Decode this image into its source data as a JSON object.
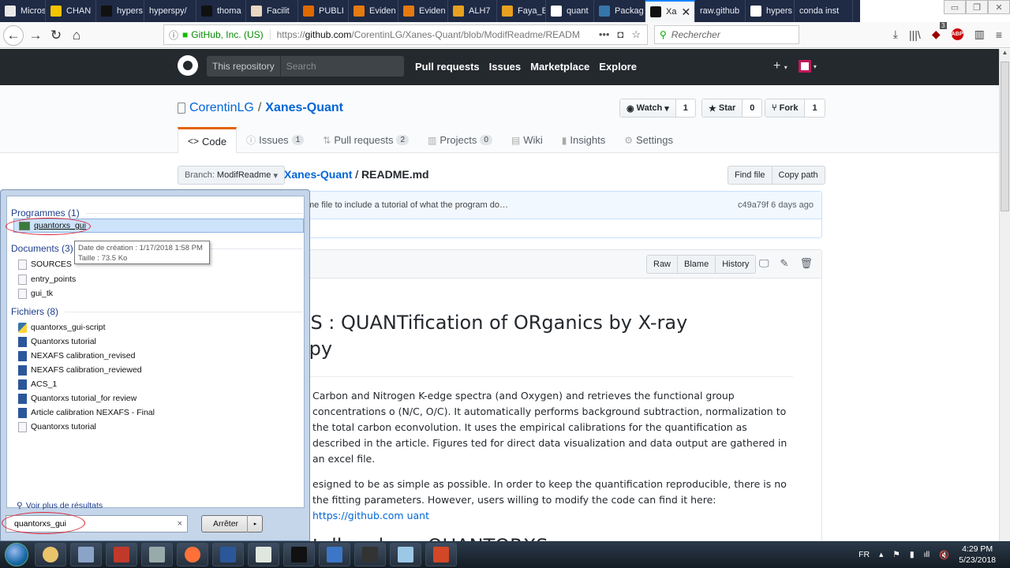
{
  "browser": {
    "tabs": [
      {
        "label": "Microsoft",
        "icon": "edge-icon",
        "color": "#e8e8e8"
      },
      {
        "label": "CHAN",
        "icon": "shield-icon",
        "color": "#f5c400"
      },
      {
        "label": "hypers",
        "icon": "github-icon",
        "color": "#111111"
      },
      {
        "label": "hyperspy/",
        "icon": "",
        "color": ""
      },
      {
        "label": "thoma",
        "icon": "github-icon",
        "color": "#111111"
      },
      {
        "label": "Facilit",
        "icon": "crest-icon",
        "color": "#e9d7c3"
      },
      {
        "label": "PUBLI",
        "icon": "jsg-icon",
        "color": "#e06a00"
      },
      {
        "label": "Eviden",
        "icon": "e-logo-icon",
        "color": "#e57a10"
      },
      {
        "label": "Eviden",
        "icon": "e-logo-icon",
        "color": "#e57a10"
      },
      {
        "label": "ALH7",
        "icon": "book-icon",
        "color": "#e8a020"
      },
      {
        "label": "Faya_E",
        "icon": "book-icon",
        "color": "#e8a020"
      },
      {
        "label": "quant",
        "icon": "package-icon",
        "color": "#ffffff"
      },
      {
        "label": "Packag",
        "icon": "python-icon",
        "color": "#3776ab"
      },
      {
        "label": "Xa",
        "icon": "github-icon",
        "color": "#111111",
        "active": true,
        "close": "✕"
      },
      {
        "label": "raw.github",
        "icon": "",
        "color": ""
      },
      {
        "label": "hypers",
        "icon": "package-icon",
        "color": "#ffffff"
      },
      {
        "label": "conda inst",
        "icon": "",
        "color": ""
      }
    ],
    "window_controls": {
      "minimize": "▭",
      "restore": "❐",
      "close": "✕"
    },
    "nav": {
      "back": "←",
      "forward": "→",
      "reload": "↻",
      "home": "⌂"
    },
    "urlbar": {
      "info": "ⓘ",
      "lock": "🔒",
      "org": "GitHub, Inc. (US)",
      "url_prefix": "https://",
      "url_domain": "github.com",
      "url_path": "/CorentinLG/Xanes-Quant/blob/ModifReadme/READM",
      "more": "•••",
      "pocket": "◘",
      "bookmark": "☆"
    },
    "search": {
      "placeholder": "Rechercher",
      "icon": "⚲"
    },
    "toolbar": {
      "download": "⤓",
      "library": "|||\\",
      "ublock_count": "3",
      "ublock": "◆",
      "abp": "ABP",
      "sidebar": "▥",
      "menu": "≡"
    }
  },
  "github": {
    "header": {
      "scope": "This repository",
      "search_placeholder": "Search",
      "nav": [
        "Pull requests",
        "Issues",
        "Marketplace",
        "Explore"
      ],
      "plus": "+",
      "caret": "▾"
    },
    "repo": {
      "owner": "CorentinLG",
      "sep": "/",
      "name": "Xanes-Quant",
      "watch": {
        "label": "Watch",
        "icon": "◉",
        "count": "1",
        "caret": "▾"
      },
      "star": {
        "label": "Star",
        "icon": "★",
        "count": "0"
      },
      "fork": {
        "label": "Fork",
        "icon": "⑂",
        "count": "1"
      },
      "tabs": [
        {
          "label": "Code",
          "icon": "<>",
          "count": null,
          "selected": true
        },
        {
          "label": "Issues",
          "icon": "ⓘ",
          "count": "1"
        },
        {
          "label": "Pull requests",
          "icon": "⇅",
          "count": "2"
        },
        {
          "label": "Projects",
          "icon": "▥",
          "count": "0"
        },
        {
          "label": "Wiki",
          "icon": "▤",
          "count": null
        },
        {
          "label": "Insights",
          "icon": "▮",
          "count": null
        },
        {
          "label": "Settings",
          "icon": "⚙",
          "count": null
        }
      ]
    },
    "file": {
      "branch_label": "Branch:",
      "branch": "ModifReadme",
      "branch_caret": "▾",
      "crumb_repo": "Xanes-Quant",
      "crumb_sep": " / ",
      "crumb_file": "README.md",
      "find_file": "Find file",
      "copy_path": "Copy path",
      "commit_message": "me file to include a tutorial of what the program do…",
      "commit_sha": "c49a79f",
      "commit_time": "6 days ago",
      "raw": "Raw",
      "blame": "Blame",
      "history": "History",
      "desktop_icon": "🖵",
      "edit_icon": "✎",
      "delete_icon": "🗑"
    },
    "readme": {
      "title_line1": "XS : QUANTification of ORganics by X-ray",
      "title_line2": "opy",
      "p1": "Carbon and Nitrogen K-edge spectra (and Oxygen) and retrieves the functional group concentrations o (N/C, O/C). It automatically performs background subtraction, normalization to the total carbon econvolution. It uses the empirical calibrations for the quantification as described in the article. Figures ted for direct data visualization and data output are gathered in an excel file.",
      "p2": "esigned to be as simple as possible. In order to keep the quantification reproducible, there is no  the fitting parameters. However, users willing to modify the code can find it here: ",
      "p2_link": "https://github.com",
      "p2_link2": "uant",
      "h2": "tall and run QUANTORXS."
    }
  },
  "start_menu": {
    "groups": [
      {
        "label": "Programmes (1)",
        "items": [
          {
            "name": "quantorxs_gui",
            "type": "app",
            "highlighted": true
          }
        ]
      },
      {
        "label": "Documents (3)",
        "items": [
          {
            "name": "SOURCES",
            "type": "doc"
          },
          {
            "name": "entry_points",
            "type": "doc"
          },
          {
            "name": "gui_tk",
            "type": "doc"
          }
        ]
      },
      {
        "label": "Fichiers (8)",
        "items": [
          {
            "name": "quantorxs_gui-script",
            "type": "py"
          },
          {
            "name": "Quantorxs tutorial",
            "type": "word"
          },
          {
            "name": "NEXAFS calibration_revised",
            "type": "word"
          },
          {
            "name": "NEXAFS calibration_reviewed",
            "type": "word"
          },
          {
            "name": "ACS_1",
            "type": "word"
          },
          {
            "name": "Quantorxs tutorial_for review",
            "type": "word"
          },
          {
            "name": "Article calibration NEXAFS - Final",
            "type": "word"
          },
          {
            "name": "Quantorxs tutorial",
            "type": "doc"
          }
        ]
      }
    ],
    "tooltip": {
      "line1": "Date de création : 1/17/2018 1:58 PM",
      "line2": "Taille : 73.5 Ko"
    },
    "more_results": "Voir plus de résultats",
    "search_value": "quantorxs_gui",
    "clear": "×",
    "shutdown": "Arrêter",
    "shutdown_arrow": "▸"
  },
  "taskbar": {
    "apps": [
      {
        "name": "explorer",
        "color": "#e9c46a"
      },
      {
        "name": "app-window",
        "color": "#8aa4c8"
      },
      {
        "name": "paint-tools",
        "color": "#c0392b"
      },
      {
        "name": "binoculars",
        "color": "#9aa"
      },
      {
        "name": "firefox",
        "color": "#ff7139"
      },
      {
        "name": "word",
        "color": "#2b579a"
      },
      {
        "name": "viewer",
        "color": "#dfe8e0"
      },
      {
        "name": "terminal",
        "color": "#111111"
      },
      {
        "name": "writer",
        "color": "#3c76c6"
      },
      {
        "name": "cmd",
        "color": "#333333"
      },
      {
        "name": "notepad",
        "color": "#9cc8e8"
      },
      {
        "name": "powerpoint",
        "color": "#d24726"
      }
    ],
    "lang": "FR",
    "tray_icons": [
      "▴",
      "⚑",
      "▮",
      "ıll",
      "🔇"
    ],
    "time": "4:29 PM",
    "date": "5/23/2018"
  }
}
